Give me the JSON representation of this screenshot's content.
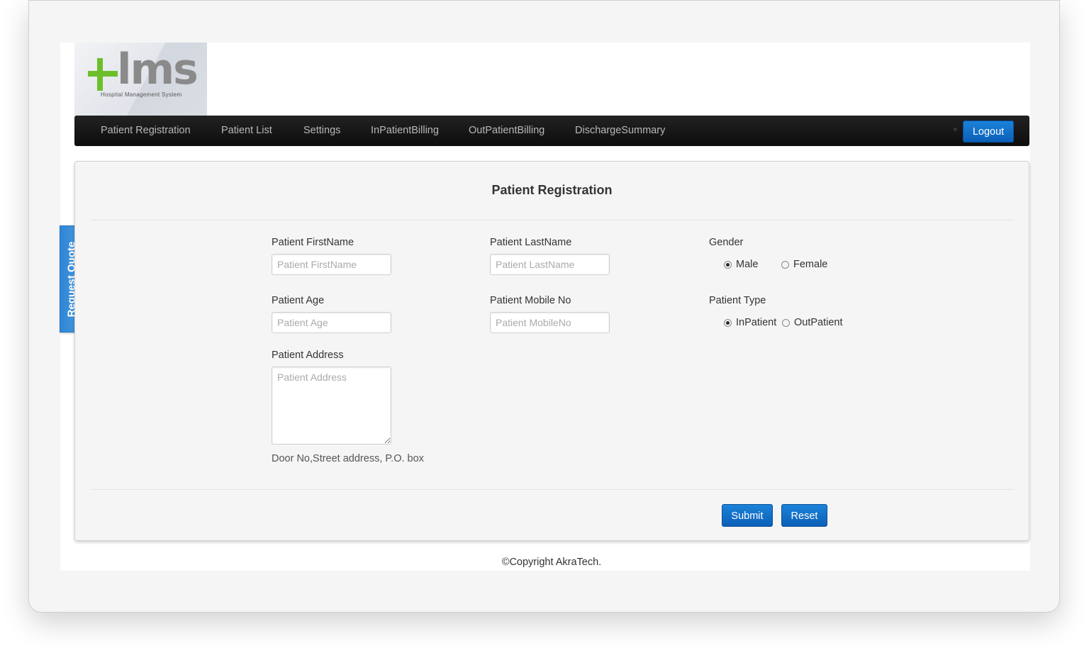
{
  "logo": {
    "mark": "lms",
    "tagline": "Hospital Management System",
    "accent_color": "#6cbf2a"
  },
  "nav": {
    "items": [
      {
        "label": "Patient Registration"
      },
      {
        "label": "Patient List"
      },
      {
        "label": "Settings"
      },
      {
        "label": "InPatientBilling"
      },
      {
        "label": "OutPatientBilling"
      },
      {
        "label": "DischargeSummary"
      }
    ],
    "logout_label": "Logout"
  },
  "form": {
    "title": "Patient Registration",
    "first_name": {
      "label": "Patient FirstName",
      "placeholder": "Patient FirstName",
      "value": ""
    },
    "last_name": {
      "label": "Patient LastName",
      "placeholder": "Patient LastName",
      "value": ""
    },
    "gender": {
      "label": "Gender",
      "options": [
        "Male",
        "Female"
      ],
      "selected": "Male"
    },
    "age": {
      "label": "Patient Age",
      "placeholder": "Patient Age",
      "value": ""
    },
    "mobile": {
      "label": "Patient Mobile No",
      "placeholder": "Patient MobileNo",
      "value": ""
    },
    "patient_type": {
      "label": "Patient Type",
      "options": [
        "InPatient",
        "OutPatient"
      ],
      "selected": "InPatient"
    },
    "address": {
      "label": "Patient Address",
      "placeholder": "Patient Address",
      "value": "",
      "help": "Door No,Street address, P.O. box"
    },
    "submit_label": "Submit",
    "reset_label": "Reset"
  },
  "quote_tab": {
    "label": "Request Quote"
  },
  "footer": {
    "text": "©Copyright AkraTech."
  },
  "colors": {
    "primary_button": "#0b5fb8",
    "navbar": "#111111",
    "panel": "#f5f5f5"
  }
}
